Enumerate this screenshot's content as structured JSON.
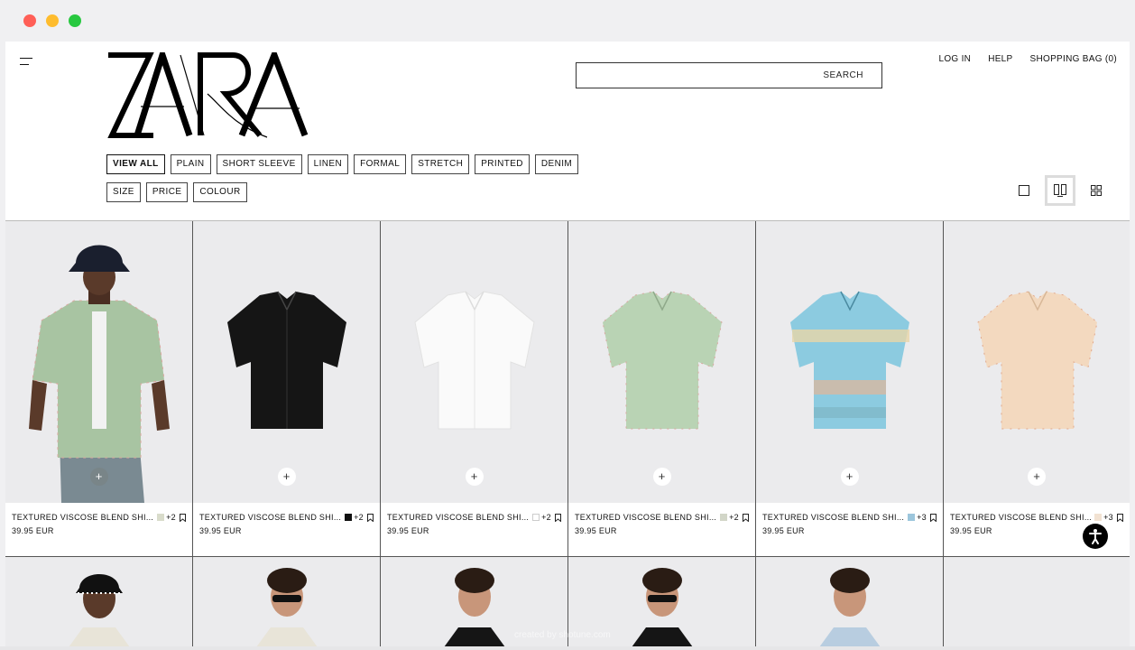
{
  "brand": {
    "logo_text": "ZARA"
  },
  "search": {
    "label": "SEARCH",
    "value": ""
  },
  "top_nav": {
    "login": "LOG IN",
    "help": "HELP",
    "bag": "SHOPPING BAG (0)"
  },
  "filters": {
    "row1": [
      "VIEW ALL",
      "PLAIN",
      "SHORT SLEEVE",
      "LINEN",
      "FORMAL",
      "STRETCH",
      "PRINTED",
      "DENIM"
    ],
    "row2": [
      "SIZE",
      "PRICE",
      "COLOUR"
    ],
    "active": "VIEW ALL"
  },
  "view_options": [
    "single-view-icon",
    "double-view-icon",
    "grid-view-icon"
  ],
  "products": [
    {
      "name": "TEXTURED VISCOSE BLEND SHI...",
      "swatch": "#d9dccb",
      "more": "+2",
      "price": "39.95 EUR",
      "add": "+"
    },
    {
      "name": "TEXTURED VISCOSE BLEND SHI...",
      "swatch": "#111111",
      "more": "+2",
      "price": "39.95 EUR",
      "add": "+"
    },
    {
      "name": "TEXTURED VISCOSE BLEND SHI...",
      "swatch": "#ffffff",
      "more": "+2",
      "price": "39.95 EUR",
      "add": "+"
    },
    {
      "name": "TEXTURED VISCOSE BLEND SHI...",
      "swatch": "#d2d6c8",
      "more": "+2",
      "price": "39.95 EUR",
      "add": "+"
    },
    {
      "name": "TEXTURED VISCOSE BLEND SHI...",
      "swatch": "#9cc6dc",
      "more": "+3",
      "price": "39.95 EUR",
      "add": "+"
    },
    {
      "name": "TEXTURED VISCOSE BLEND SHI...",
      "swatch": "#f2e2d2",
      "more": "+3",
      "price": "39.95 EUR",
      "add": "+"
    }
  ],
  "watermark": "created by shotune.com"
}
